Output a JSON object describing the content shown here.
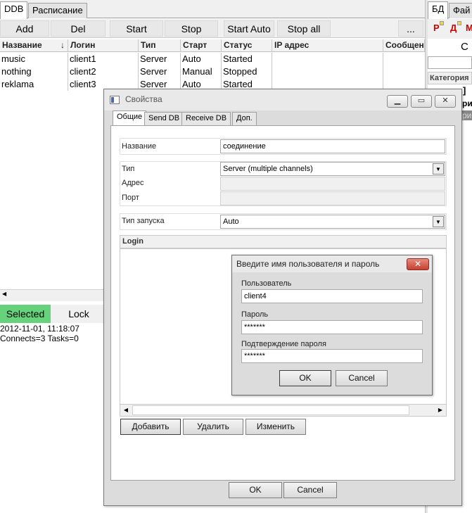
{
  "main_tabs": [
    "DDB",
    "Расписание"
  ],
  "toolbar": {
    "add": "Add",
    "del": "Del",
    "start": "Start",
    "stop": "Stop",
    "start_auto": "Start Auto",
    "stop_all": "Stop all",
    "more": "..."
  },
  "grid": {
    "headers": [
      "Название",
      "Логин",
      "Тип",
      "Старт",
      "Статус",
      "IP адрес",
      "Сообщен"
    ],
    "sort_icon": "↓",
    "rows": [
      [
        "music",
        "client1",
        "Server",
        "Auto",
        "Started"
      ],
      [
        "nothing",
        "client2",
        "Server",
        "Manual",
        "Stopped"
      ],
      [
        "reklama",
        "client3",
        "Server",
        "Auto",
        "Started"
      ]
    ]
  },
  "bottom": {
    "selected": "Selected",
    "lock": "Lock"
  },
  "log": [
    "2012-11-01, 11:18:07",
    "Connects=3 Tasks=0"
  ],
  "right_panel": {
    "tabs": [
      "БД",
      "Фай"
    ],
    "tool_letters": [
      "Р",
      "Д",
      "М"
    ],
    "header_letter": "С",
    "category": "Категория",
    "bracket": "]",
    "fragment": "ри",
    "fragment2": "ри"
  },
  "props": {
    "title": "Свойства",
    "tabs": [
      "Общие",
      "Send DB",
      "Receive DB",
      "Доп."
    ],
    "name_label": "Название",
    "name_value": "соединение",
    "type_label": "Тип",
    "type_value": "Server (multiple channels)",
    "address_label": "Адрес",
    "port_label": "Порт",
    "start_type_label": "Тип запуска",
    "start_type_value": "Auto",
    "login_section": "Login",
    "add_btn": "Добавить",
    "del_btn": "Удалить",
    "edit_btn": "Изменить",
    "ok": "OK",
    "cancel": "Cancel"
  },
  "login_dialog": {
    "title": "Введите имя пользователя и пароль",
    "user_label": "Пользователь",
    "user_value": "client4",
    "pass_label": "Пароль",
    "pass_value": "*******",
    "confirm_label": "Подтверждение пароля",
    "confirm_value": "*******",
    "ok": "OK",
    "cancel": "Cancel"
  }
}
